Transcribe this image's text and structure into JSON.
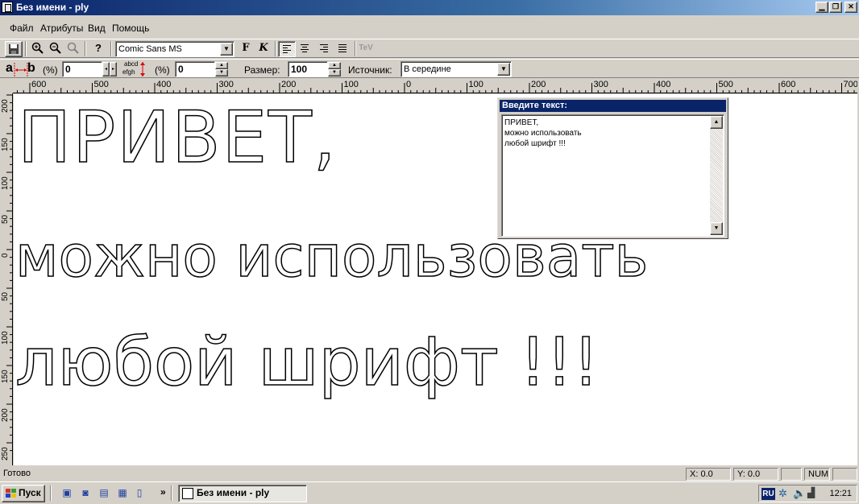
{
  "window": {
    "title": "Без имени - ply"
  },
  "menu": [
    "Файл",
    "Атрибуты",
    "Вид",
    "Помощь"
  ],
  "toolbar1": {
    "font_name": "Comic Sans MS",
    "bold_label": "F",
    "italic_label": "K",
    "tev_label": "TeV"
  },
  "toolbar2": {
    "spacing_label_a": "a",
    "spacing_label_b": "b",
    "percent1": "(%)",
    "char_spacing": "0",
    "abcd": "abcd",
    "efgh": "efgh",
    "percent2": "(%)",
    "line_spacing": "0",
    "size_label": "Размер:",
    "size_value": "100",
    "source_label": "Источник:",
    "source_value": "В середине"
  },
  "hruler_labels": [
    "600",
    "500",
    "400",
    "300",
    "200",
    "100",
    "0",
    "100",
    "200",
    "300",
    "400",
    "500",
    "600",
    "700"
  ],
  "vruler_labels": [
    "2",
    "200",
    "150",
    "100",
    "50",
    "0",
    "50",
    "100",
    "150",
    "200",
    "250",
    "300"
  ],
  "canvas": {
    "line1": "ПРИВЕТ,",
    "line2": "можно использовать",
    "line3": "любой шрифт !!!"
  },
  "dialog": {
    "title": "Введите текст:",
    "lines": [
      "ПРИВЕТ,",
      "можно использовать",
      "любой шрифт !!!"
    ]
  },
  "statusbar": {
    "status": "Готово",
    "x": "X: 0.0",
    "y": "Y: 0.0",
    "num": "NUM"
  },
  "taskbar": {
    "start": "Пуск",
    "more": "»",
    "task": "Без имени - ply",
    "lang": "RU",
    "clock": "12:21"
  }
}
